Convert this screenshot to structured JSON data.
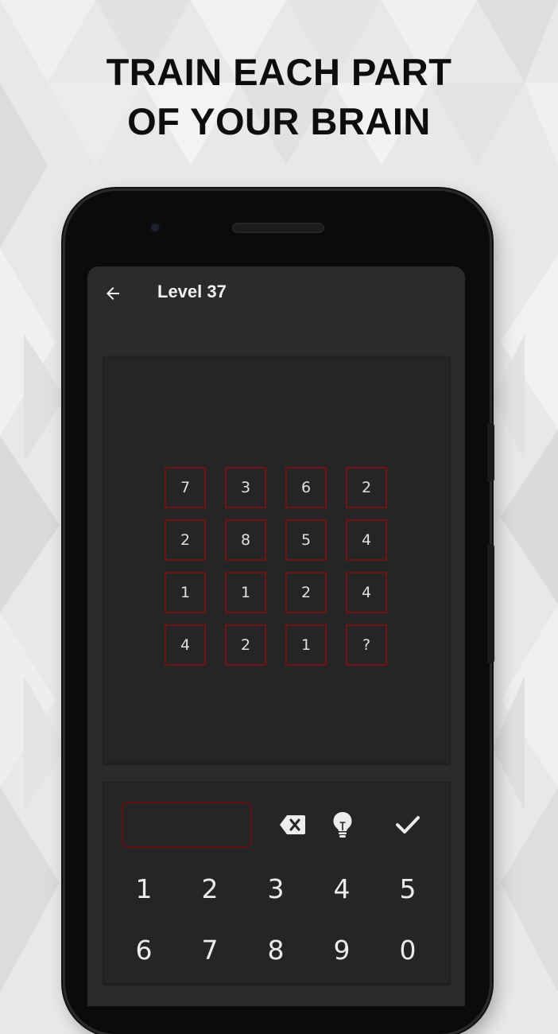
{
  "promo": {
    "headline_line1": "TRAIN EACH PART",
    "headline_line2": "OF YOUR BRAIN"
  },
  "colors": {
    "background": "#e9e9e9",
    "screen": "#2b2b2b",
    "card": "#252525",
    "cell_border": "#6e1414",
    "text": "#e0e0e0"
  },
  "app_bar": {
    "back_icon": "arrow-left-icon",
    "title": "Level 37"
  },
  "puzzle": {
    "rows": [
      [
        "7",
        "3",
        "6",
        "2"
      ],
      [
        "2",
        "8",
        "5",
        "4"
      ],
      [
        "1",
        "1",
        "2",
        "4"
      ],
      [
        "4",
        "2",
        "1",
        "?"
      ]
    ]
  },
  "keypad": {
    "answer_value": "",
    "tools": [
      {
        "name": "backspace-icon"
      },
      {
        "name": "lightbulb-icon"
      },
      {
        "name": "checkmark-icon"
      }
    ],
    "keys": [
      "1",
      "2",
      "3",
      "4",
      "5",
      "6",
      "7",
      "8",
      "9",
      "0"
    ]
  }
}
